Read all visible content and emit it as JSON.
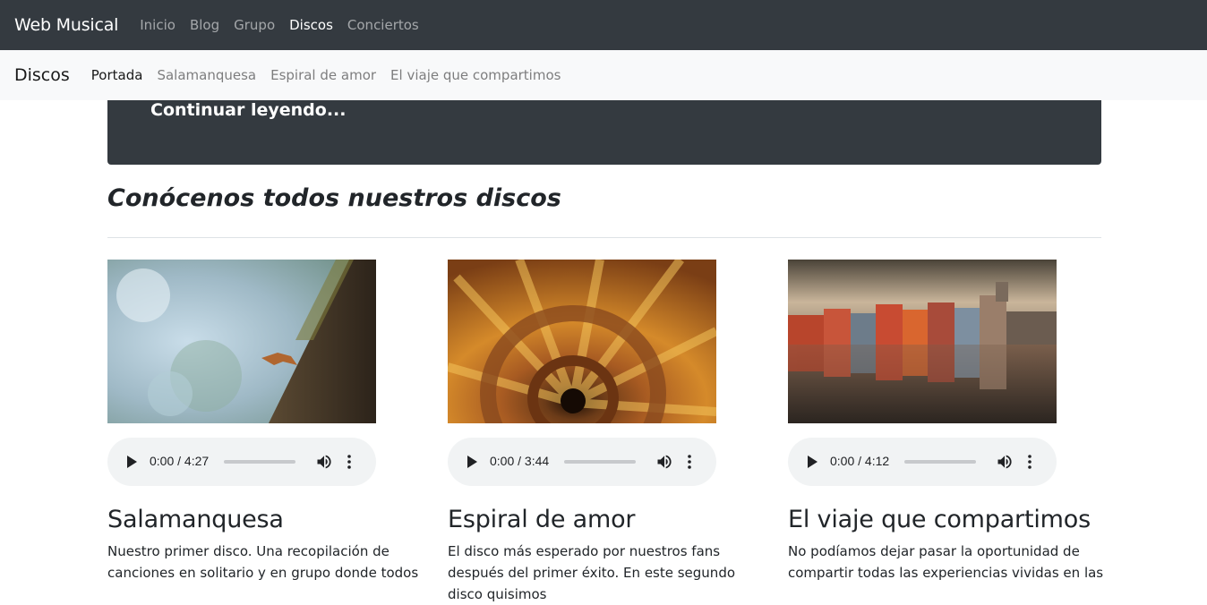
{
  "topnav": {
    "brand": "Web Musical",
    "links": [
      "Inicio",
      "Blog",
      "Grupo",
      "Discos",
      "Conciertos"
    ],
    "active": "Discos"
  },
  "subnav": {
    "brand": "Discos",
    "links": [
      "Portada",
      "Salamanquesa",
      "Espiral de amor",
      "El viaje que compartimos"
    ],
    "active": "Portada"
  },
  "jumbo": {
    "link": "Continuar leyendo..."
  },
  "section": {
    "title": "Conócenos todos nuestros discos"
  },
  "albums": [
    {
      "title": "Salamanquesa",
      "time": "0:00 / 4:27",
      "description": "Nuestro primer disco. Una recopilación de canciones en solitario y en grupo donde todos"
    },
    {
      "title": "Espiral de amor",
      "time": "0:00 / 3:44",
      "description": "El disco más esperado por nuestros fans después del primer éxito. En este segundo disco quisimos"
    },
    {
      "title": "El viaje que compartimos",
      "time": "0:00 / 4:12",
      "description": "No podíamos dejar pasar la oportunidad de compartir todas las experiencias vividas en las"
    }
  ],
  "icons": {
    "play": "play-icon",
    "volume": "volume-icon",
    "more": "more-vertical-icon"
  }
}
